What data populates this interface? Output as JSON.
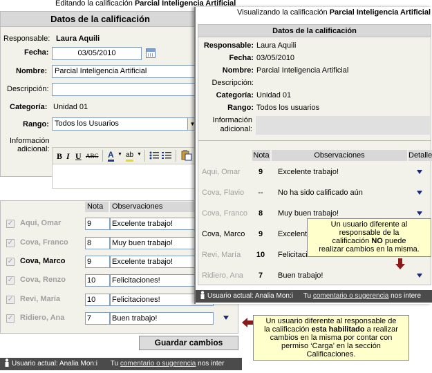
{
  "edit": {
    "caption_prefix": "Editando la calificación",
    "caption_title": "Parcial Inteligencia Artificial",
    "header": "Datos de la calificación",
    "responsable_label": "Responsable:",
    "responsable_value": "Laura Aquili",
    "fecha_label": "Fecha:",
    "fecha_value": "03/05/2010",
    "nombre_label": "Nombre:",
    "nombre_value": "Parcial Inteligencia Artificial",
    "descripcion_label": "Descripción:",
    "descripcion_value": "",
    "categoria_label": "Categoría:",
    "categoria_value": "Unidad 01",
    "rango_label": "Rango:",
    "rango_value": "Todos los Usuarios",
    "info_label_1": "Información",
    "info_label_2": "adicional:",
    "toolbar": {
      "bold": "B",
      "italic": "I",
      "underline": "U",
      "strike": "ABC"
    },
    "grades_headers": {
      "nota": "Nota",
      "observaciones": "Observaciones"
    },
    "grades": [
      {
        "name": "Aqui, Omar",
        "nota": "9",
        "obs": "Excelente trabajo!",
        "active": false
      },
      {
        "name": "Cova, Franco",
        "nota": "8",
        "obs": "Muy buen trabajo!",
        "active": false
      },
      {
        "name": "Cova, Marco",
        "nota": "9",
        "obs": "Excelente trabajo!",
        "active": true
      },
      {
        "name": "Cova, Renzo",
        "nota": "10",
        "obs": "Felicitaciones!",
        "active": false
      },
      {
        "name": "Revi, María",
        "nota": "10",
        "obs": "Felicitaciones!",
        "active": false
      },
      {
        "name": "Ridiero, Ana",
        "nota": "7",
        "obs": "Buen trabajo!",
        "active": false
      }
    ],
    "save_label": "Guardar cambios",
    "status": {
      "user": "Usuario actual: Analia Mon:i",
      "prefix": "Tu",
      "link": "comentario o sugerencia",
      "suffix": "nos inter"
    }
  },
  "view": {
    "caption_prefix": "Visualizando la calificación",
    "caption_title": "Parcial Inteligencia Artificial",
    "header": "Datos de la calificación",
    "responsable_label": "Responsable:",
    "responsable_value": "Laura Aquili",
    "fecha_label": "Fecha:",
    "fecha_value": "03/05/2010",
    "nombre_label": "Nombre:",
    "nombre_value": "Parcial Inteligencia Artificial",
    "descripcion_label": "Descripción:",
    "categoria_label": "Categoría:",
    "categoria_value": "Unidad 01",
    "rango_label": "Rango:",
    "rango_value": "Todos los usuarios",
    "info_label_1": "Información",
    "info_label_2": "adicional:",
    "grades_headers": {
      "nota": "Nota",
      "observaciones": "Observaciones",
      "detalle": "Detalle"
    },
    "grades": [
      {
        "name": "Aqui, Omar",
        "nota": "9",
        "obs": "Excelente trabajo!",
        "active": false
      },
      {
        "name": "Cova, Flavio",
        "nota": "--",
        "obs": "No ha sido calificado aún",
        "active": false
      },
      {
        "name": "Cova, Franco",
        "nota": "8",
        "obs": "Muy buen trabajo!",
        "active": false
      },
      {
        "name": "Cova, Marco",
        "nota": "9",
        "obs": "Excelente trabajo!",
        "active": true
      },
      {
        "name": "Revi, María",
        "nota": "10",
        "obs": "Felicitaciones!",
        "active": false
      },
      {
        "name": "Ridiero, Ana",
        "nota": "7",
        "obs": "Buen trabajo!",
        "active": false
      }
    ],
    "status": {
      "user": "Usuario actual: Analia Mon:i",
      "prefix": "Tu",
      "link": "comentario o sugerencia",
      "suffix": "nos intere"
    }
  },
  "notes": {
    "view_note_1": "Un usuario diferente al",
    "view_note_2": "responsable de la",
    "view_note_3a": "calificación",
    "view_note_3b": "NO",
    "view_note_3c": "puede",
    "view_note_4": "realizar cambios en la misma.",
    "edit_note_1": "Un usuario diferente al responsable de",
    "edit_note_2a": "la calificación",
    "edit_note_2b": "esta habilitado",
    "edit_note_2c": "a realizar",
    "edit_note_3": "cambios en la misma por contar con",
    "edit_note_4": "permiso ‘Carga’ en la sección",
    "edit_note_5": "Calificaciones."
  },
  "colors": {
    "arrow_red": "#8b1a1a",
    "detail_triangle": "#1c2a7a",
    "note_bg": "#ffffcc",
    "statusbar": "#4b4b4b"
  },
  "icons": [
    "calendar-icon",
    "dropdown-arrow-icon",
    "font-color-icon",
    "highlight-icon",
    "bullet-list-icon",
    "numbered-list-icon",
    "paste-icon",
    "checkbox-icon",
    "detail-triangle-icon",
    "user-icon",
    "red-arrow-icon"
  ]
}
